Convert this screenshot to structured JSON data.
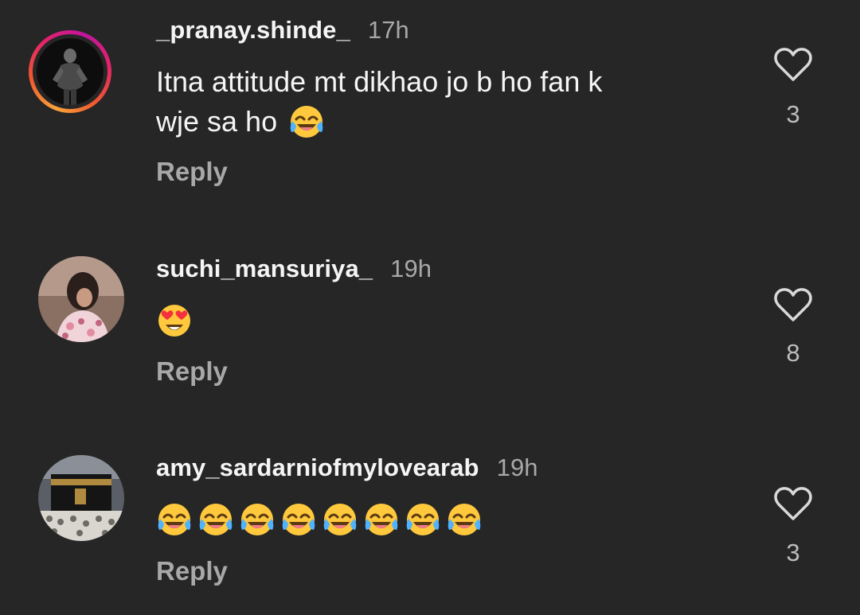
{
  "comments": [
    {
      "username": "_pranay.shinde_",
      "time": "17h",
      "text_line1": "Itna attitude mt dikhao jo b ho fan k",
      "text_line2": "wje sa ho",
      "emojis": [
        "face-with-tears-of-joy"
      ],
      "reply_label": "Reply",
      "likes": "3",
      "has_story_ring": true
    },
    {
      "username": "suchi_mansuriya_",
      "time": "19h",
      "emojis": [
        "smiling-face-with-heart-eyes"
      ],
      "reply_label": "Reply",
      "likes": "8",
      "has_story_ring": false
    },
    {
      "username": "amy_sardarniofmylovearab",
      "time": "19h",
      "emojis": [
        "face-with-tears-of-joy",
        "face-with-tears-of-joy",
        "face-with-tears-of-joy",
        "face-with-tears-of-joy",
        "face-with-tears-of-joy",
        "face-with-tears-of-joy",
        "face-with-tears-of-joy",
        "face-with-tears-of-joy"
      ],
      "reply_label": "Reply",
      "likes": "3",
      "has_story_ring": false
    }
  ],
  "icons": {
    "like": "heart-outline-icon"
  },
  "colors": {
    "background": "#262626",
    "text_primary": "#f5f5f5",
    "text_secondary": "#a8a8a8",
    "story_ring_start": "#f9a43a",
    "story_ring_end": "#c2159f"
  }
}
